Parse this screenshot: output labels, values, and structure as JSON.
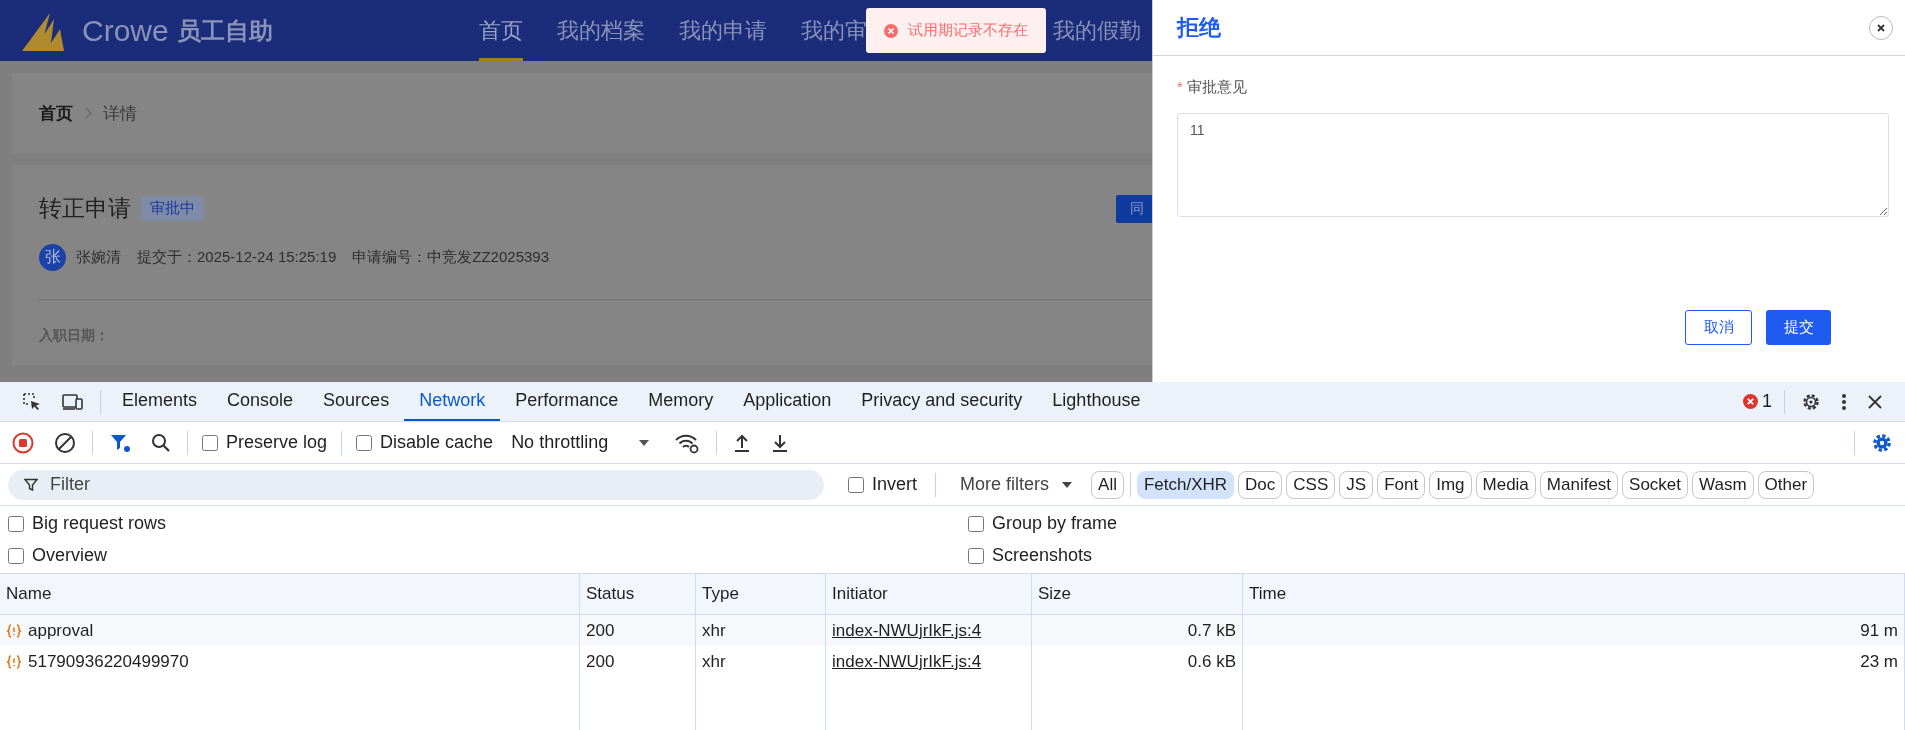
{
  "app": {
    "logo_text": "Crowe",
    "app_name": "员工自助",
    "nav": [
      {
        "label": "首页",
        "selected": true
      },
      {
        "label": "我的档案",
        "selected": false
      },
      {
        "label": "我的申请",
        "selected": false
      },
      {
        "label": "我的审",
        "selected": false
      },
      {
        "label": "我的假勤",
        "selected": false
      }
    ],
    "breadcrumb": [
      "首页",
      "详情"
    ],
    "title": "转正申请",
    "status_tag": "审批中",
    "action_button": "同",
    "avatar": "张",
    "applicant": "张婉清",
    "submitted": "提交于：2025-12-24 15:25:19",
    "number": "申请编号：中竞发ZZ2025393",
    "field_label": "入职日期："
  },
  "toast": {
    "kind": "error",
    "message": "试用期记录不存在"
  },
  "drawer": {
    "title": "拒绝",
    "field_label": "审批意见",
    "required_mark": "*",
    "value": "11",
    "buttons": [
      {
        "label": "取消",
        "kind": "secondary"
      },
      {
        "label": "提交",
        "kind": "primary"
      }
    ]
  },
  "devtools": {
    "tabs": [
      {
        "label": "Elements",
        "selected": false
      },
      {
        "label": "Console",
        "selected": false
      },
      {
        "label": "Sources",
        "selected": false
      },
      {
        "label": "Network",
        "selected": true
      },
      {
        "label": "Performance",
        "selected": false
      },
      {
        "label": "Memory",
        "selected": false
      },
      {
        "label": "Application",
        "selected": false
      },
      {
        "label": "Privacy and security",
        "selected": false
      },
      {
        "label": "Lighthouse",
        "selected": false
      }
    ],
    "error_count": "1",
    "toolbar": {
      "recording": true,
      "filter_active": true,
      "preserve_log": {
        "label": "Preserve log",
        "checked": false
      },
      "disable_cache": {
        "label": "Disable cache",
        "checked": false
      },
      "throttling": "No throttling"
    },
    "filter_placeholder": "Filter",
    "invert": {
      "label": "Invert",
      "checked": false
    },
    "more_filters": "More filters",
    "type_filters": [
      {
        "label": "All",
        "selected": false
      },
      {
        "label": "Fetch/XHR",
        "selected": true
      },
      {
        "label": "Doc",
        "selected": false
      },
      {
        "label": "CSS",
        "selected": false
      },
      {
        "label": "JS",
        "selected": false
      },
      {
        "label": "Font",
        "selected": false
      },
      {
        "label": "Img",
        "selected": false
      },
      {
        "label": "Media",
        "selected": false
      },
      {
        "label": "Manifest",
        "selected": false
      },
      {
        "label": "Socket",
        "selected": false
      },
      {
        "label": "Wasm",
        "selected": false
      },
      {
        "label": "Other",
        "selected": false
      }
    ],
    "options": [
      {
        "label": "Big request rows",
        "checked": false
      },
      {
        "label": "Group by frame",
        "checked": false
      },
      {
        "label": "Overview",
        "checked": false
      },
      {
        "label": "Screenshots",
        "checked": false
      }
    ],
    "table": {
      "columns": [
        "Name",
        "Status",
        "Type",
        "Initiator",
        "Size",
        "Time"
      ],
      "rows": [
        {
          "name": "approval",
          "status": "200",
          "type": "xhr",
          "initiator": "index-NWUjrIkF.js:4",
          "size": "0.7 kB",
          "time": "91 m"
        },
        {
          "name": "51790936220499970",
          "status": "200",
          "type": "xhr",
          "initiator": "index-NWUjrIkF.js:4",
          "size": "0.6 kB",
          "time": "23 m"
        }
      ]
    }
  }
}
